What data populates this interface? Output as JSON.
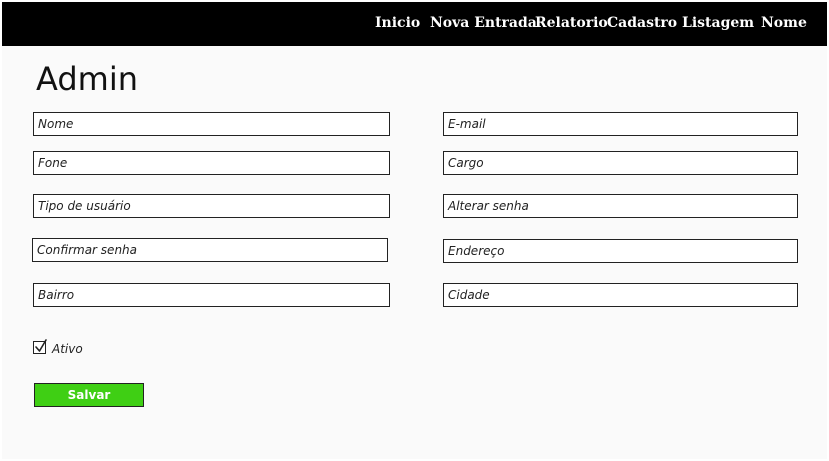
{
  "nav": {
    "items": [
      {
        "label": "Inicio"
      },
      {
        "label": "Nova Entrada"
      },
      {
        "label": "Relatorio"
      },
      {
        "label": "Cadastro"
      },
      {
        "label": "Listagem"
      },
      {
        "label": "Nome"
      }
    ]
  },
  "page": {
    "title": "Admin"
  },
  "form": {
    "nome": "Nome",
    "email": "E-mail",
    "fone": "Fone",
    "cargo": "Cargo",
    "tipo_usuario": "Tipo de usuário",
    "alterar_senha": "Alterar senha",
    "confirmar_senha": "Confirmar senha",
    "endereco": "Endereço",
    "bairro": "Bairro",
    "cidade": "Cidade",
    "ativo_label": "Ativo",
    "ativo_checked": true,
    "save_label": "Salvar"
  },
  "colors": {
    "navbar": "#000000",
    "background": "#fafafa",
    "save_button": "#3fcf14"
  }
}
